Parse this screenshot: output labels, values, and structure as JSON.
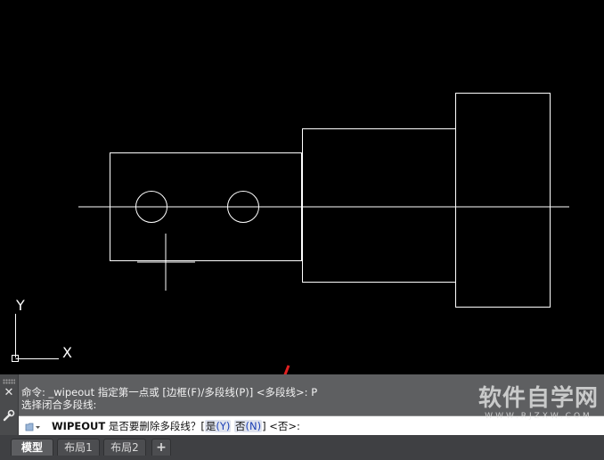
{
  "ucs": {
    "y_label": "Y",
    "x_label": "X"
  },
  "watermark": {
    "title": "软件自学网",
    "url": "WWW.RJZXW.COM"
  },
  "command_history": {
    "line1": "命令: _wipeout 指定第一点或 [边框(F)/多段线(P)] <多段线>: P",
    "line2": "选择闭合多段线:"
  },
  "command_prompt": {
    "command": "WIPEOUT",
    "question": "是否要删除多段线？[",
    "option_yes": "是",
    "option_yes_key": "(Y)",
    "option_no": "否",
    "option_no_key": "(N)",
    "tail": "] <否>:"
  },
  "tabs": {
    "model": "模型",
    "layout1": "布局1",
    "layout2": "布局2",
    "add": "+"
  },
  "colors": {
    "canvas": "#000000",
    "lines": "#ffffff",
    "panel": "#5e5f61",
    "annotation_arrow": "#e02020"
  }
}
